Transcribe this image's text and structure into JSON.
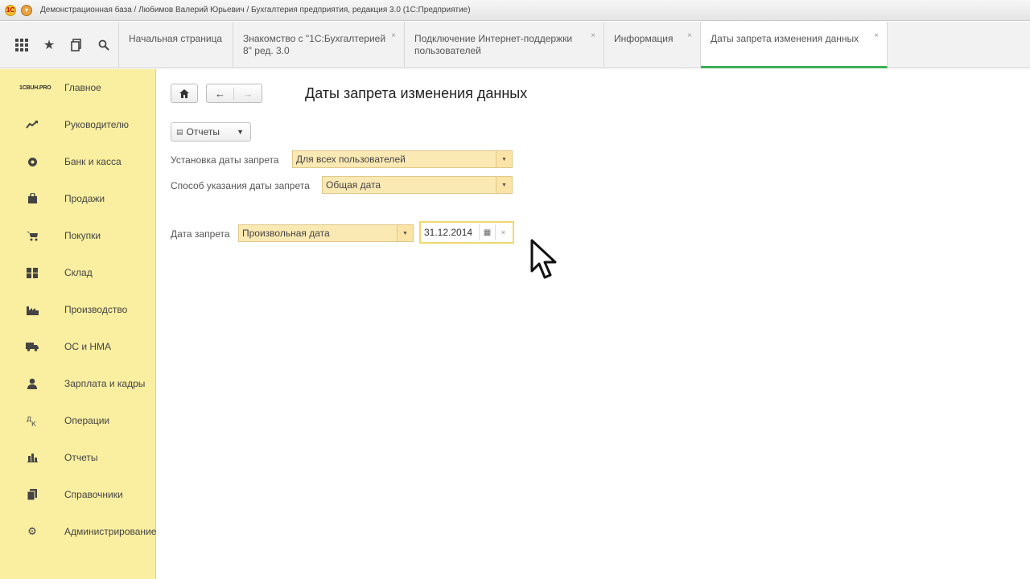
{
  "window": {
    "title": "Демонстрационная база / Любимов Валерий Юрьевич / Бухгалтерия предприятия, редакция 3.0  (1С:Предприятие)"
  },
  "toolbar": {
    "icons": [
      "grid-icon",
      "star-icon",
      "history-icon",
      "search-icon"
    ],
    "tabs": [
      {
        "label": "Начальная страница",
        "closable": false
      },
      {
        "label": "Знакомство с \"1С:Бухгалтерией 8\" ред. 3.0",
        "closable": true
      },
      {
        "label": "Подключение Интернет-поддержки пользователей",
        "closable": true
      },
      {
        "label": "Информация",
        "closable": true
      },
      {
        "label": "Даты запрета изменения данных",
        "closable": true,
        "active": true
      }
    ],
    "close_glyph": "×"
  },
  "sidebar": {
    "brand": "1CBUH.PRO",
    "items": [
      {
        "label": "Главное",
        "icon": "brand-logo"
      },
      {
        "label": "Руководителю",
        "icon": "trend-icon"
      },
      {
        "label": "Банк и касса",
        "icon": "coin-icon"
      },
      {
        "label": "Продажи",
        "icon": "bag-icon"
      },
      {
        "label": "Покупки",
        "icon": "cart-icon"
      },
      {
        "label": "Склад",
        "icon": "warehouse-icon"
      },
      {
        "label": "Производство",
        "icon": "factory-icon"
      },
      {
        "label": "ОС и НМА",
        "icon": "truck-icon"
      },
      {
        "label": "Зарплата и кадры",
        "icon": "person-icon"
      },
      {
        "label": "Операции",
        "icon": "operations-icon"
      },
      {
        "label": "Отчеты",
        "icon": "chart-icon"
      },
      {
        "label": "Справочники",
        "icon": "book-icon"
      },
      {
        "label": "Администрирование",
        "icon": "gear-icon"
      }
    ]
  },
  "main": {
    "title": "Даты запрета изменения данных",
    "reports_button": "Отчеты",
    "fields": {
      "setup_label": "Установка даты запрета",
      "setup_value": "Для всех пользователей",
      "method_label": "Способ указания даты запрета",
      "method_value": "Общая дата",
      "date_label": "Дата запрета",
      "date_kind_value": "Произвольная дата",
      "date_value": "31.12.2014"
    }
  },
  "colors": {
    "sidebar_bg": "#faeea0",
    "field_bg": "#fbe9b4",
    "active_tab_accent": "#3cb054"
  }
}
